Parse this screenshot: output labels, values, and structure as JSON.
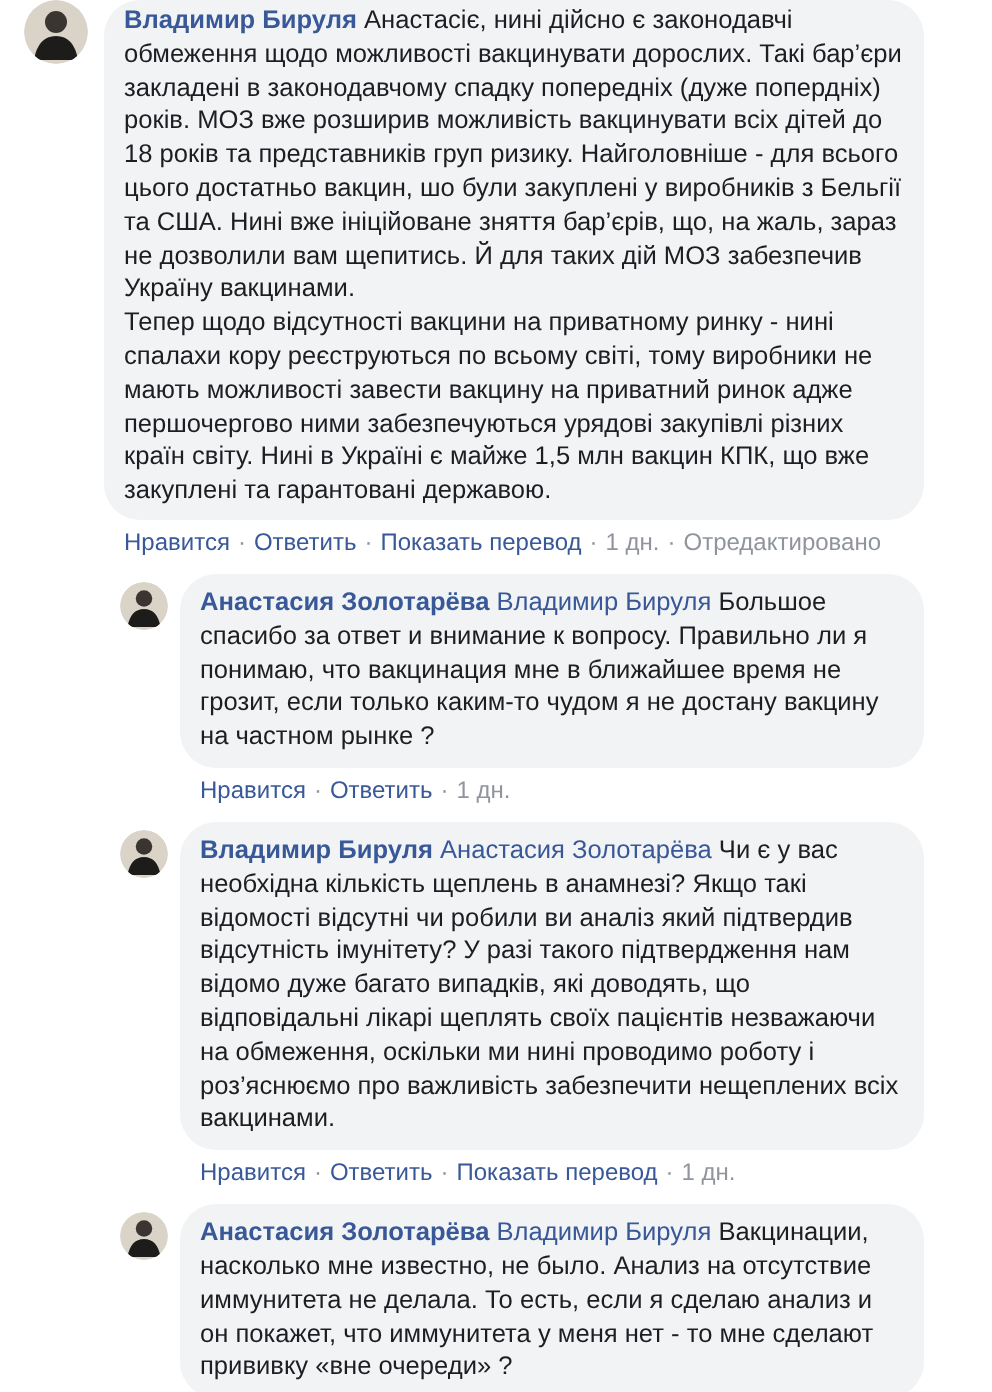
{
  "comments": [
    {
      "author": "Владимир Бируля",
      "text": "Анастасіє, нині дійсно є законодавчі обмеження щодо можливості вакцинувати дорослих. Такі бар’єри закладені в законодавчому спадку попередніх (дуже попердніх) років. МОЗ вже розширив можливість вакцинувати всіх дітей до 18 років та представників груп ризику. Найголовніше - для всього цього достатньо вакцин, шо були закуплені у виробників з Бельгії та США. Нині вже ініційоване зняття бар’єрів, що, на жаль, зараз не дозволили вам щепитись. Й для таких дій МОЗ забезпечив Україну вакцинами.\nТепер щодо відсутності вакцини на приватному ринку - нині спалахи кору реєструються по всьому світі, тому виробники не мають можливості завести вакцину на приватний ринок адже першочергово ними забезпечуються урядові закупівлі різних країн світу. Нині в Україні є майже 1,5 млн вакцин КПК, що вже закуплені та гарантовані державою.",
      "actions": [
        {
          "kind": "link",
          "label": "Нравится"
        },
        {
          "kind": "separator",
          "label": "·"
        },
        {
          "kind": "link",
          "label": "Ответить"
        },
        {
          "kind": "separator",
          "label": "·"
        },
        {
          "kind": "link",
          "label": "Показать перевод"
        },
        {
          "kind": "separator",
          "label": "·"
        },
        {
          "kind": "meta",
          "label": "1 дн."
        },
        {
          "kind": "separator",
          "label": "·"
        },
        {
          "kind": "meta",
          "label": "Отредактировано"
        }
      ],
      "replies": [
        {
          "author": "Анастасия Золотарёва",
          "mention": "Владимир Бируля",
          "text": "Большое спасибо за ответ и внимание к вопросу. Правильно ли я понимаю, что вакцинация мне в ближайшее время не грозит, если только каким-то чудом я не достану вакцину на частном рынке ?",
          "actions": [
            {
              "kind": "link",
              "label": "Нравится"
            },
            {
              "kind": "separator",
              "label": "·"
            },
            {
              "kind": "link",
              "label": "Ответить"
            },
            {
              "kind": "separator",
              "label": "·"
            },
            {
              "kind": "meta",
              "label": "1 дн."
            }
          ]
        },
        {
          "author": "Владимир Бируля",
          "mention": "Анастасия Золотарёва",
          "text": "Чи є у вас необхідна кількість щеплень в анамнезі? Якщо такі відомості відсутні чи робили ви аналіз який підтвердив відсутність імунітету? У разі такого підтвердження нам відомо дуже багато випадків, які доводять, що відповідальні лікарі щеплять своїх пацієнтів незважаючи на обмеження, оскільки ми нині проводимо роботу і роз’яснюємо про важливість забезпечити нещеплених всіх вакцинами.",
          "actions": [
            {
              "kind": "link",
              "label": "Нравится"
            },
            {
              "kind": "separator",
              "label": "·"
            },
            {
              "kind": "link",
              "label": "Ответить"
            },
            {
              "kind": "separator",
              "label": "·"
            },
            {
              "kind": "link",
              "label": "Показать перевод"
            },
            {
              "kind": "separator",
              "label": "·"
            },
            {
              "kind": "meta",
              "label": "1 дн."
            }
          ]
        },
        {
          "author": "Анастасия Золотарёва",
          "mention": "Владимир Бируля",
          "text": "Вакцинации, насколько мне известно, не было. Анализ на отсутствие иммунитета не делала. То есть, если я сделаю анализ и он покажет, что иммунитета у меня нет - то мне сделают прививку «вне очереди» ?"
        }
      ]
    }
  ]
}
